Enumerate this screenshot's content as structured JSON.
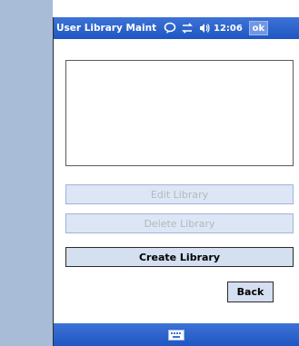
{
  "window": {
    "title": "User Library Maint",
    "clock": "12:06",
    "ok_label": "ok"
  },
  "icons": {
    "speech": "speech-bubble-icon",
    "connectivity": "connectivity-icon",
    "volume": "volume-icon",
    "keyboard": "keyboard-icon"
  },
  "library_list": {
    "items": []
  },
  "buttons": {
    "edit": "Edit Library",
    "delete": "Delete Library",
    "create": "Create Library",
    "back": "Back"
  },
  "colors": {
    "titlebar": "#2f66cf",
    "button_fill": "#d4dff0",
    "frame": "#a8bcd8"
  }
}
